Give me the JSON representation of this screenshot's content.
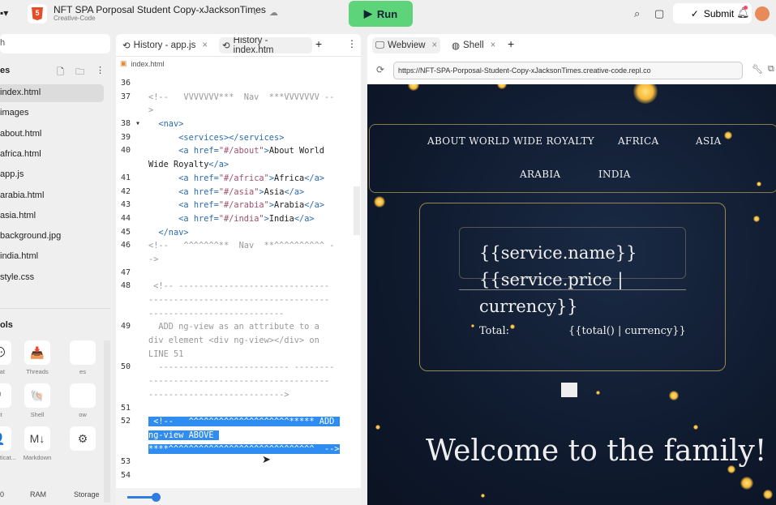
{
  "header": {
    "project_title": "NFT SPA Porposal Student Copy-xJacksonTimes",
    "project_sub": "Creative-Code",
    "run_label": "Run",
    "submit_label": "Submit",
    "icons": [
      "search-icon",
      "chat-icon",
      "bell-icon"
    ]
  },
  "sidebar": {
    "search_placeholder": "h",
    "files_heading": "es",
    "files": [
      "index.html",
      "images",
      "about.html",
      "africa.html",
      "app.js",
      "arabia.html",
      "asia.html",
      "background.jpg",
      "india.html",
      "style.css"
    ],
    "tools_heading": "ols",
    "tools": [
      {
        "label": "Chat",
        "icon": "💬"
      },
      {
        "label": "Threads",
        "icon": "📥"
      },
      {
        "label": "es",
        "icon": ""
      },
      {
        "label": "Git",
        "icon": "⑂"
      },
      {
        "label": "Shell",
        "icon": "🐚"
      },
      {
        "label": "ow",
        "icon": ""
      },
      {
        "label": "Authenticat...",
        "icon": "👤"
      },
      {
        "label": "Markdown",
        "icon": "M↓"
      },
      {
        "label": "",
        "icon": "⚙"
      }
    ],
    "resources": [
      "0",
      "RAM",
      "Storage"
    ]
  },
  "editor": {
    "tabs": [
      "History - app.js",
      "History - index.htm"
    ],
    "breadcrumb": "index.html",
    "lines": [
      {
        "n": "36",
        "segs": []
      },
      {
        "n": "37",
        "segs": [
          [
            "c-com",
            "<!--   VVVVVVV***  Nav  ***VVVVVVV --"
          ]
        ]
      },
      {
        "n": "",
        "segs": [
          [
            "c-com",
            ">"
          ]
        ],
        "cont": true
      },
      {
        "n": "38 ▾",
        "segs": [
          [
            "c-plain",
            "  "
          ],
          [
            "c-tag",
            "<nav>"
          ]
        ]
      },
      {
        "n": "39",
        "segs": [
          [
            "c-plain",
            "      "
          ],
          [
            "c-tag",
            "<services></services>"
          ]
        ]
      },
      {
        "n": "40",
        "segs": [
          [
            "c-plain",
            "      "
          ],
          [
            "c-tag",
            "<a "
          ],
          [
            "c-attr",
            "href="
          ],
          [
            "c-str",
            "\"#/about\""
          ],
          [
            "c-tag",
            ">"
          ],
          [
            "c-plain",
            "About World"
          ]
        ]
      },
      {
        "n": "",
        "segs": [
          [
            "c-plain",
            "Wide Royalty"
          ],
          [
            "c-tag",
            "</a>"
          ]
        ],
        "cont": true
      },
      {
        "n": "41",
        "segs": [
          [
            "c-plain",
            "      "
          ],
          [
            "c-tag",
            "<a "
          ],
          [
            "c-attr",
            "href="
          ],
          [
            "c-str",
            "\"#/africa\""
          ],
          [
            "c-tag",
            ">"
          ],
          [
            "c-plain",
            "Africa"
          ],
          [
            "c-tag",
            "</a>"
          ]
        ]
      },
      {
        "n": "42",
        "segs": [
          [
            "c-plain",
            "      "
          ],
          [
            "c-tag",
            "<a "
          ],
          [
            "c-attr",
            "href="
          ],
          [
            "c-str",
            "\"#/asia\""
          ],
          [
            "c-tag",
            ">"
          ],
          [
            "c-plain",
            "Asia"
          ],
          [
            "c-tag",
            "</a>"
          ]
        ]
      },
      {
        "n": "43",
        "segs": [
          [
            "c-plain",
            "      "
          ],
          [
            "c-tag",
            "<a "
          ],
          [
            "c-attr",
            "href="
          ],
          [
            "c-str",
            "\"#/arabia\""
          ],
          [
            "c-tag",
            ">"
          ],
          [
            "c-plain",
            "Arabia"
          ],
          [
            "c-tag",
            "</a>"
          ]
        ]
      },
      {
        "n": "44",
        "segs": [
          [
            "c-plain",
            "      "
          ],
          [
            "c-tag",
            "<a "
          ],
          [
            "c-attr",
            "href="
          ],
          [
            "c-str",
            "\"#/india\""
          ],
          [
            "c-tag",
            ">"
          ],
          [
            "c-plain",
            "India"
          ],
          [
            "c-tag",
            "</a>"
          ]
        ]
      },
      {
        "n": "45",
        "segs": [
          [
            "c-plain",
            "  "
          ],
          [
            "c-tag",
            "</nav>"
          ]
        ]
      },
      {
        "n": "46",
        "segs": [
          [
            "c-com",
            "<!--   ^^^^^^^**  Nav  **^^^^^^^^^^ -"
          ]
        ]
      },
      {
        "n": "",
        "segs": [
          [
            "c-com",
            "->"
          ]
        ],
        "cont": true
      },
      {
        "n": "47",
        "segs": []
      },
      {
        "n": "48",
        "segs": [
          [
            "c-com",
            " <!-- ------------------------------"
          ]
        ]
      },
      {
        "n": "",
        "segs": [
          [
            "c-com",
            "------------------------------------"
          ]
        ],
        "cont": true
      },
      {
        "n": "",
        "segs": [
          [
            "c-com",
            "---------------------------"
          ]
        ],
        "cont": true
      },
      {
        "n": "49",
        "segs": [
          [
            "c-com",
            "  ADD ng-view as an attribute to a"
          ]
        ]
      },
      {
        "n": "",
        "segs": [
          [
            "c-com",
            "div element <div ng-view></div> on"
          ]
        ],
        "cont": true
      },
      {
        "n": "",
        "segs": [
          [
            "c-com",
            "LINE 51"
          ]
        ],
        "cont": true
      },
      {
        "n": "50",
        "segs": [
          [
            "c-com",
            "  -------------------------- --------"
          ]
        ]
      },
      {
        "n": "",
        "segs": [
          [
            "c-com",
            "------------------------------------"
          ]
        ],
        "cont": true
      },
      {
        "n": "",
        "segs": [
          [
            "c-com",
            "--------------------------->"
          ]
        ],
        "cont": true
      },
      {
        "n": "51",
        "segs": []
      },
      {
        "n": "52",
        "segs": [
          [
            "sel",
            " <!--   ^^^^^^^^^^^^^^^^^^^^***** ADD "
          ]
        ]
      },
      {
        "n": "",
        "segs": [
          [
            "sel",
            "ng-view ABOVE "
          ]
        ],
        "cont": true
      },
      {
        "n": "",
        "segs": [
          [
            "sel",
            "****^^^^^^^^^^^^^^^^^^^^^^^^^^^^^  -->"
          ]
        ],
        "cont": true
      },
      {
        "n": "53",
        "segs": []
      },
      {
        "n": "54",
        "segs": []
      }
    ]
  },
  "webview": {
    "tabs": [
      "Webview",
      "Shell"
    ],
    "url": "https://NFT-SPA-Porposal-Student-Copy-xJacksonTimes.creative-code.repl.co",
    "nav": [
      "ABOUT WORLD WIDE ROYALTY",
      "AFRICA",
      "ASIA",
      "ARABIA",
      "INDIA"
    ],
    "service_name": "{{service.name}}",
    "service_price": "{{service.price |",
    "service_currency": "currency}}",
    "total_label": "Total:",
    "total_value": "{{total() | currency}}",
    "welcome": "Welcome to the family!"
  }
}
